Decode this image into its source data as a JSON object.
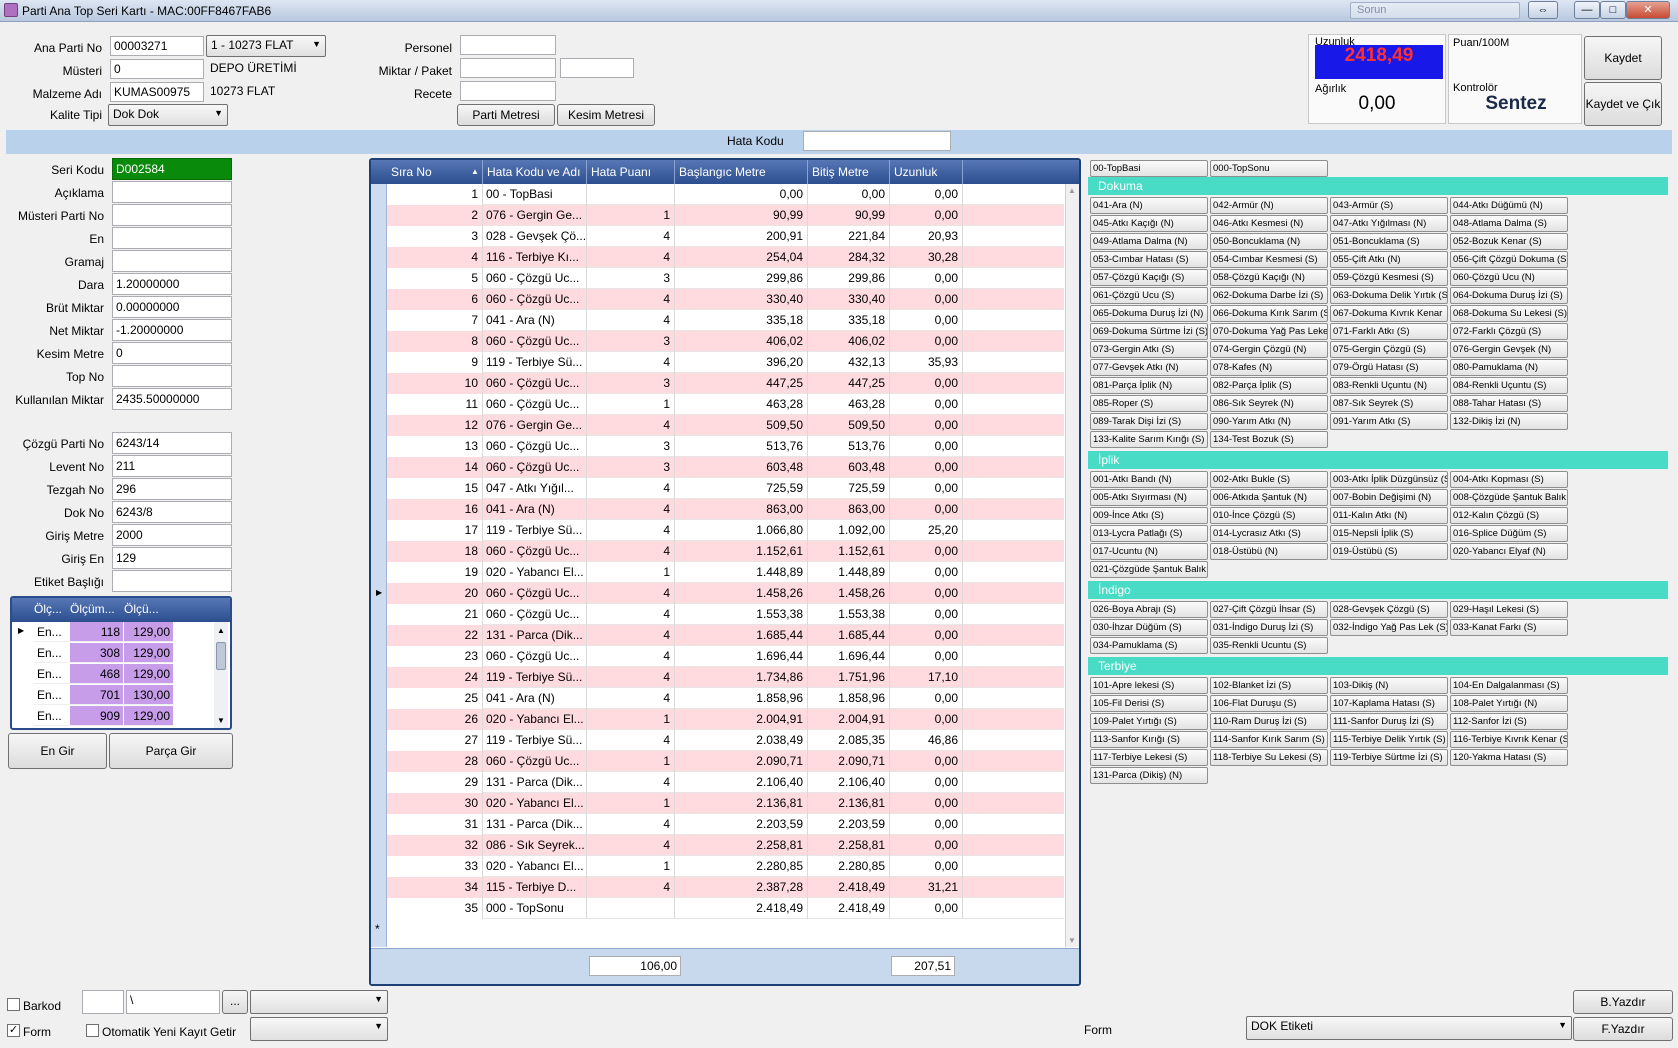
{
  "window": {
    "title": "Parti Ana Top Seri Kartı - MAC:00FF8467FAB6",
    "search_placeholder": "Sorun",
    "btn_restore": "⇔",
    "btn_min": "—",
    "btn_max": "□",
    "btn_close": "✕"
  },
  "header": {
    "ana_parti_no_label": "Ana Parti No",
    "ana_parti_no": "00003271",
    "ana_parti_combo": "1 - 10273 FLAT",
    "musteri_label": "Müsteri",
    "musteri": "0",
    "musteri_name": "DEPO ÜRETİMİ",
    "malzeme_label": "Malzeme Adı",
    "malzeme": "KUMAS00975",
    "malzeme_name": "10273 FLAT",
    "kalite_label": "Kalite Tipi",
    "kalite": "Dok Dok",
    "personel_label": "Personel",
    "miktar_label": "Miktar / Paket",
    "recete_label": "Recete",
    "parti_metresi_btn": "Parti Metresi",
    "kesim_metresi_btn": "Kesim Metresi",
    "uzunluk_label": "Uzunluk",
    "uzunluk_value": "2418,49",
    "agirlik_label": "Ağırlık",
    "agirlik_value": "0,00",
    "puan_label": "Puan/100M",
    "kontrolor_label": "Kontrolör",
    "kontrolor_value": "Sentez",
    "kaydet_btn": "Kaydet",
    "kaydet_cik_btn": "Kaydet ve Çık",
    "hata_kodu_label": "Hata Kodu"
  },
  "left": {
    "fields": [
      {
        "label": "Seri Kodu",
        "value": "D002584"
      },
      {
        "label": "Açıklama",
        "value": ""
      },
      {
        "label": "Müsteri Parti No",
        "value": ""
      },
      {
        "label": "En",
        "value": ""
      },
      {
        "label": "Gramaj",
        "value": ""
      },
      {
        "label": "Dara",
        "value": "1.20000000"
      },
      {
        "label": "Brüt Miktar",
        "value": "0.00000000"
      },
      {
        "label": "Net Miktar",
        "value": "-1.20000000"
      },
      {
        "label": "Kesim Metre",
        "value": "0"
      },
      {
        "label": "Top No",
        "value": ""
      },
      {
        "label": "Kullanılan Miktar",
        "value": "2435.50000000"
      }
    ],
    "fields2": [
      {
        "label": "Çözgü Parti No",
        "value": "6243/14"
      },
      {
        "label": "Levent No",
        "value": "211"
      },
      {
        "label": "Tezgah No",
        "value": "296"
      },
      {
        "label": "Dok No",
        "value": "6243/8"
      },
      {
        "label": "Giriş Metre",
        "value": "2000"
      },
      {
        "label": "Giriş En",
        "value": "129"
      },
      {
        "label": "Etiket Başlığı",
        "value": ""
      }
    ],
    "measure_headers": [
      "Ölç...",
      "Ölçüm...",
      "Ölçü..."
    ],
    "measure_rows": [
      [
        "En...",
        "118",
        "129,00"
      ],
      [
        "En...",
        "308",
        "129,00"
      ],
      [
        "En...",
        "468",
        "129,00"
      ],
      [
        "En...",
        "701",
        "130,00"
      ],
      [
        "En...",
        "909",
        "129,00"
      ]
    ],
    "en_gir_btn": "En Gir",
    "parca_gir_btn": "Parça Gir"
  },
  "grid": {
    "headers": [
      "Sıra No",
      "Hata Kodu ve Adı",
      "Hata Puanı",
      "Başlangıc Metre",
      "Bitiş Metre",
      "Uzunluk"
    ],
    "rows": [
      [
        "1",
        "00 - TopBasi",
        "",
        "0,00",
        "0,00",
        "0,00"
      ],
      [
        "2",
        "076 - Gergin Ge...",
        "1",
        "90,99",
        "90,99",
        "0,00"
      ],
      [
        "3",
        "028 - Gevşek Çö...",
        "4",
        "200,91",
        "221,84",
        "20,93"
      ],
      [
        "4",
        "116 - Terbiye Kı...",
        "4",
        "254,04",
        "284,32",
        "30,28"
      ],
      [
        "5",
        "060 - Çözgü Uc...",
        "3",
        "299,86",
        "299,86",
        "0,00"
      ],
      [
        "6",
        "060 - Çözgü Uc...",
        "4",
        "330,40",
        "330,40",
        "0,00"
      ],
      [
        "7",
        "041 - Ara (N)",
        "4",
        "335,18",
        "335,18",
        "0,00"
      ],
      [
        "8",
        "060 - Çözgü Uc...",
        "3",
        "406,02",
        "406,02",
        "0,00"
      ],
      [
        "9",
        "119 - Terbiye Sü...",
        "4",
        "396,20",
        "432,13",
        "35,93"
      ],
      [
        "10",
        "060 - Çözgü Uc...",
        "3",
        "447,25",
        "447,25",
        "0,00"
      ],
      [
        "11",
        "060 - Çözgü Uc...",
        "1",
        "463,28",
        "463,28",
        "0,00"
      ],
      [
        "12",
        "076 - Gergin Ge...",
        "4",
        "509,50",
        "509,50",
        "0,00"
      ],
      [
        "13",
        "060 - Çözgü Uc...",
        "3",
        "513,76",
        "513,76",
        "0,00"
      ],
      [
        "14",
        "060 - Çözgü Uc...",
        "3",
        "603,48",
        "603,48",
        "0,00"
      ],
      [
        "15",
        "047 - Atkı Yığıl...",
        "4",
        "725,59",
        "725,59",
        "0,00"
      ],
      [
        "16",
        "041 - Ara (N)",
        "4",
        "863,00",
        "863,00",
        "0,00"
      ],
      [
        "17",
        "119 - Terbiye Sü...",
        "4",
        "1.066,80",
        "1.092,00",
        "25,20"
      ],
      [
        "18",
        "060 - Çözgü Uc...",
        "4",
        "1.152,61",
        "1.152,61",
        "0,00"
      ],
      [
        "19",
        "020 - Yabancı El...",
        "1",
        "1.448,89",
        "1.448,89",
        "0,00"
      ],
      [
        "20",
        "060 - Çözgü Uc...",
        "4",
        "1.458,26",
        "1.458,26",
        "0,00"
      ],
      [
        "21",
        "060 - Çözgü Uc...",
        "4",
        "1.553,38",
        "1.553,38",
        "0,00"
      ],
      [
        "22",
        "131 - Parca (Dik...",
        "4",
        "1.685,44",
        "1.685,44",
        "0,00"
      ],
      [
        "23",
        "060 - Çözgü Uc...",
        "4",
        "1.696,44",
        "1.696,44",
        "0,00"
      ],
      [
        "24",
        "119 - Terbiye Sü...",
        "4",
        "1.734,86",
        "1.751,96",
        "17,10"
      ],
      [
        "25",
        "041 - Ara (N)",
        "4",
        "1.858,96",
        "1.858,96",
        "0,00"
      ],
      [
        "26",
        "020 - Yabancı El...",
        "1",
        "2.004,91",
        "2.004,91",
        "0,00"
      ],
      [
        "27",
        "119 - Terbiye Sü...",
        "4",
        "2.038,49",
        "2.085,35",
        "46,86"
      ],
      [
        "28",
        "060 - Çözgü Uc...",
        "1",
        "2.090,71",
        "2.090,71",
        "0,00"
      ],
      [
        "29",
        "131 - Parca (Dik...",
        "4",
        "2.106,40",
        "2.106,40",
        "0,00"
      ],
      [
        "30",
        "020 - Yabancı El...",
        "1",
        "2.136,81",
        "2.136,81",
        "0,00"
      ],
      [
        "31",
        "131 - Parca (Dik...",
        "4",
        "2.203,59",
        "2.203,59",
        "0,00"
      ],
      [
        "32",
        "086 - Sık Seyrek...",
        "4",
        "2.258,81",
        "2.258,81",
        "0,00"
      ],
      [
        "33",
        "020 - Yabancı El...",
        "1",
        "2.280,85",
        "2.280,85",
        "0,00"
      ],
      [
        "34",
        "115 - Terbiye D...",
        "4",
        "2.387,28",
        "2.418,49",
        "31,21"
      ],
      [
        "35",
        "000 - TopSonu",
        "",
        "2.418,49",
        "2.418,49",
        "0,00"
      ]
    ],
    "total_puan": "106,00",
    "total_uzunluk": "207,51"
  },
  "defects": {
    "top": [
      "00-TopBasi",
      "000-TopSonu"
    ],
    "sections": [
      {
        "title": "Dokuma",
        "items": [
          "041-Ara (N)",
          "042-Armür (N)",
          "043-Armür (S)",
          "044-Atkı Düğümü (N)",
          "045-Atkı Kaçığı (N)",
          "046-Atkı Kesmesi (N)",
          "047-Atkı Yığılması (N)",
          "048-Atlama Dalma (S)",
          "049-Atlama Dalma (N)",
          "050-Boncuklama (N)",
          "051-Boncuklama (S)",
          "052-Bozuk Kenar (S)",
          "053-Cımbar Hatası (S)",
          "054-Cımbar Kesmesi (S)",
          "055-Çift Atkı (N)",
          "056-Çift Çözgü Dokuma (S)",
          "057-Çözgü Kaçığı (S)",
          "058-Çözgü Kaçığı (N)",
          "059-Çözgü Kesmesi (S)",
          "060-Çözgü Ucu (N)",
          "061-Çözgü Ucu (S)",
          "062-Dokuma Darbe İzi (S)",
          "063-Dokuma Delik Yırtık (S)",
          "064-Dokuma Duruş İzi (S)",
          "065-Dokuma Duruş İzi (N)",
          "066-Dokuma Kırık Sarım (S)",
          "067-Dokuma Kıvrık Kenar",
          "068-Dokuma Su Lekesi (S)",
          "069-Dokuma Sürtme İzi (S)",
          "070-Dokuma Yağ Pas Leke",
          "071-Farklı Atkı (S)",
          "072-Farklı Çözgü (S)",
          "073-Gergin Atkı (S)",
          "074-Gergin Çözgü (N)",
          "075-Gergin Çözgü (S)",
          "076-Gergin Gevşek (N)",
          "077-Gevşek Atkı (N)",
          "078-Kafes (N)",
          "079-Örgü Hatası (S)",
          "080-Pamuklama (N)",
          "081-Parça İplik (N)",
          "082-Parça İplik (S)",
          "083-Renkli Uçuntu (N)",
          "084-Renkli Uçuntu (S)",
          "085-Roper (S)",
          "086-Sık Seyrek (N)",
          "087-Sık Seyrek (S)",
          "088-Tahar Hatası (S)",
          "089-Tarak Dişi İzi (S)",
          "090-Yarım Atkı (N)",
          "091-Yarım Atkı (S)",
          "132-Dikiş İzi (N)",
          "133-Kalite Sarım Kırığı (S)",
          "134-Test Bozuk (S)"
        ]
      },
      {
        "title": "İplik",
        "items": [
          "001-Atkı Bandı (N)",
          "002-Atkı Bukle (S)",
          "003-Atkı İplik Düzgünsüz (S)",
          "004-Atkı Kopması (S)",
          "005-Atkı Sıyırması (N)",
          "006-Atkıda Şantuk (N)",
          "007-Bobin Değişimi (N)",
          "008-Çözgüde Şantuk Balık",
          "009-İnce Atkı (S)",
          "010-İnce Çözgü (S)",
          "011-Kalın Atkı (N)",
          "012-Kalın Çözgü (S)",
          "013-Lycra Patlağı (S)",
          "014-Lycrasız Atkı (S)",
          "015-Nepsli İplik (S)",
          "016-Splice Düğüm (S)",
          "017-Ucuntu (N)",
          "018-Üstübü (N)",
          "019-Üstübü (S)",
          "020-Yabancı Elyaf (N)",
          "021-Çözgüde Şantuk Balık"
        ]
      },
      {
        "title": "İndigo",
        "items": [
          "026-Boya Abrajı (S)",
          "027-Çift Çözgü İhsar (S)",
          "028-Gevşek Çözgü (S)",
          "029-Haşıl Lekesi (S)",
          "030-İhzar Düğüm (S)",
          "031-İndigo Duruş İzi (S)",
          "032-İndigo Yağ Pas Lek (S)",
          "033-Kanat Farkı (S)",
          "034-Pamuklama (S)",
          "035-Renkli Ucuntu (S)"
        ]
      },
      {
        "title": "Terbiye",
        "items": [
          "101-Apre lekesi (S)",
          "102-Blanket İzi (S)",
          "103-Dikiş (N)",
          "104-En Dalgalanması (S)",
          "105-Fil Derisi (S)",
          "106-Flat Duruşu (S)",
          "107-Kaplama Hatası (S)",
          "108-Palet Yırtığı (N)",
          "109-Palet Yırtığı (S)",
          "110-Ram Duruş İzi (S)",
          "111-Sanfor Duruş İzi (S)",
          "112-Sanfor İzi (S)",
          "113-Sanfor Kırığı (S)",
          "114-Sanfor Kırık Sarım (S)",
          "115-Terbiye Delik Yırtık (S)",
          "116-Terbiye Kıvrık Kenar (S)",
          "117-Terbiye Lekesi (S)",
          "118-Terbiye Su Lekesi (S)",
          "119-Terbiye Sürtme İzi (S)",
          "120-Yakma Hatası (S)",
          "131-Parca (Dikiş) (N)"
        ]
      }
    ]
  },
  "bottom": {
    "barkod_label": "Barkod",
    "barkod_path": "\\",
    "browse_btn": "...",
    "form_label": "Form",
    "form_checked": "✓",
    "otomatik_label": "Otomatik Yeni Kayıt Getir",
    "form2_label": "Form",
    "form_combo": "DOK Etiketi",
    "byazdir_btn": "B.Yazdır",
    "fyazdir_btn": "F.Yazdır"
  }
}
